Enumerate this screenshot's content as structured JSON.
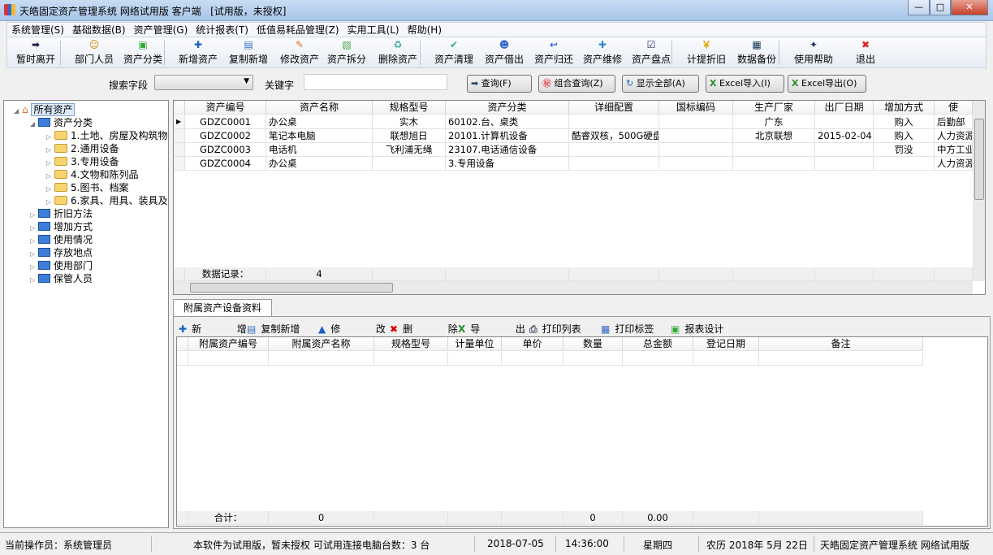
{
  "window": {
    "title": "天皓固定资产管理系统 网络试用版 客户端",
    "license": "[试用版，未授权]",
    "min": "—",
    "max": "□",
    "close": "✕"
  },
  "menu": [
    "系统管理(S)",
    "基础数据(B)",
    "资产管理(G)",
    "统计报表(T)",
    "低值易耗品管理(Z)",
    "实用工具(L)",
    "帮助(H)"
  ],
  "toolbar": [
    {
      "label": "暂时离开",
      "icon": "exit-arrow-icon"
    },
    {
      "label": "部门人员",
      "icon": "people-icon"
    },
    {
      "label": "资产分类",
      "icon": "category-icon"
    },
    {
      "label": "新增资产",
      "icon": "plus-icon"
    },
    {
      "label": "复制新增",
      "icon": "copy-icon"
    },
    {
      "label": "修改资产",
      "icon": "edit-icon"
    },
    {
      "label": "资产拆分",
      "icon": "split-icon"
    },
    {
      "label": "删除资产",
      "icon": "recycle-icon"
    },
    {
      "label": "资产清理",
      "icon": "clean-icon"
    },
    {
      "label": "资产借出",
      "icon": "lend-icon"
    },
    {
      "label": "资产归还",
      "icon": "return-icon"
    },
    {
      "label": "资产维修",
      "icon": "repair-icon"
    },
    {
      "label": "资产盘点",
      "icon": "checkbox-icon"
    },
    {
      "label": "计提折旧",
      "icon": "money-icon"
    },
    {
      "label": "数据备份",
      "icon": "save-icon"
    },
    {
      "label": "使用帮助",
      "icon": "help-book-icon"
    },
    {
      "label": "退出",
      "icon": "close-icon"
    }
  ],
  "search": {
    "field_label": "搜索字段",
    "field_value": "",
    "keyword_label": "关键字",
    "keyword_value": "",
    "buttons": [
      "查询(F)",
      "组合查询(Z)",
      "显示全部(A)",
      "Excel导入(I)",
      "Excel导出(O)"
    ]
  },
  "tree": {
    "root": "所有资产",
    "category": "资产分类",
    "category_children": [
      "1.土地、房屋及构筑物",
      "2.通用设备",
      "3.专用设备",
      "4.文物和陈列品",
      "5.图书、档案",
      "6.家具、用具、装具及"
    ],
    "others": [
      "折旧方法",
      "增加方式",
      "使用情况",
      "存放地点",
      "使用部门",
      "保管人员"
    ]
  },
  "assets": {
    "columns": [
      "资产编号",
      "资产名称",
      "规格型号",
      "资产分类",
      "详细配置",
      "国标编码",
      "生产厂家",
      "出厂日期",
      "增加方式",
      "使"
    ],
    "rows": [
      [
        "GDZC0001",
        "办公桌",
        "实木",
        "60102.台、桌类",
        "",
        "",
        "广东",
        "",
        "购入",
        "后勤部"
      ],
      [
        "GDZC0002",
        "笔记本电脑",
        "联想旭日",
        "20101.计算机设备",
        "酷睿双核，500G硬盘",
        "",
        "北京联想",
        "2015-02-04",
        "购入",
        "人力资源"
      ],
      [
        "GDZC0003",
        "电话机",
        "飞利浦无绳",
        "23107.电话通信设备",
        "",
        "",
        "",
        "",
        "罚没",
        "中方工业"
      ],
      [
        "GDZC0004",
        "办公桌",
        "",
        "3.专用设备",
        "",
        "",
        "",
        "",
        "",
        "人力资源"
      ]
    ],
    "footer_label": "数据记录：",
    "footer_count": "4"
  },
  "sub": {
    "tab": "附属资产设备资料",
    "actions": [
      "新  增",
      "复制新增",
      "修  改",
      "删  除",
      "导  出",
      "打印列表",
      "打印标签",
      "报表设计"
    ],
    "columns": [
      "附属资产编号",
      "附属资产名称",
      "规格型号",
      "计量单位",
      "单价",
      "数量",
      "总金额",
      "登记日期",
      "备注"
    ],
    "footer": [
      "合计：",
      "0",
      "",
      "",
      "",
      "0",
      "0.00",
      "",
      ""
    ]
  },
  "status": {
    "operator": "当前操作员：系统管理员",
    "notice": "本软件为试用版，暂未授权  可试用连接电脑台数：3 台",
    "date": "2018-07-05",
    "time": "14:36:00",
    "weekday": "星期四",
    "lunar": "农历  2018年 5月 22日",
    "product": "天皓固定资产管理系统  网络试用版"
  }
}
